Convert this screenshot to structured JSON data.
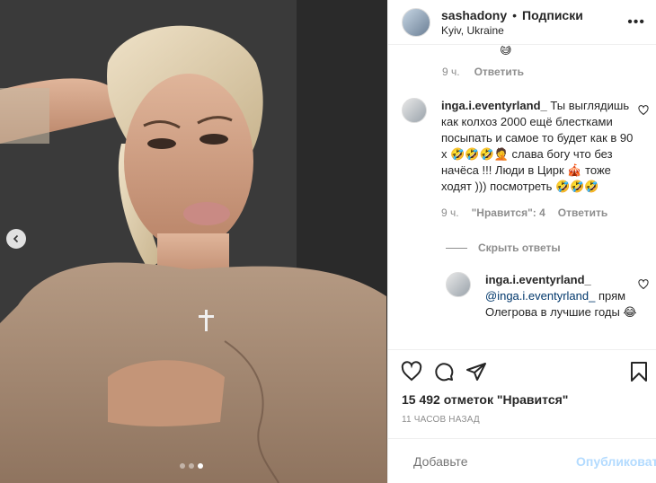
{
  "post": {
    "username": "sashadony",
    "separator": "•",
    "follow_label": "Подписки",
    "location": "Kyiv, Ukraine",
    "more_label": "•••"
  },
  "previous_comment": {
    "emoji": "😅",
    "time": "9 ч.",
    "reply_label": "Ответить"
  },
  "comments": [
    {
      "username": "inga.i.eventyrland_",
      "text": "Ты выглядишь как колхоз 2000 ещё блестками посыпать и самое то будет как в 90 х 🤣🤣🤣🤦 слава богу что без начёса !!! Люди в Цирк 🎪 тоже ходят ))) посмотреть 🤣🤣🤣",
      "time": "9 ч.",
      "likes_label": "\"Нравится\": 4",
      "reply_label": "Ответить"
    }
  ],
  "hide_replies_label": "Скрыть ответы",
  "reply": {
    "username": "inga.i.eventyrland_",
    "mention": "@inga.i.eventyrland_",
    "text": " прям Олегрова в лучшие годы 😂"
  },
  "likes_text": "15 492 отметок \"Нравится\"",
  "time_ago": "11 ЧАСОВ НАЗАД",
  "comment_box": {
    "placeholder": "Добавьте",
    "publish_label": "Опубликовать"
  },
  "carousel": {
    "dots": 3,
    "active_index": 2
  },
  "colors": {
    "link": "#00376b",
    "muted": "#8e8e8e",
    "publish_disabled": "#b3dbff"
  }
}
